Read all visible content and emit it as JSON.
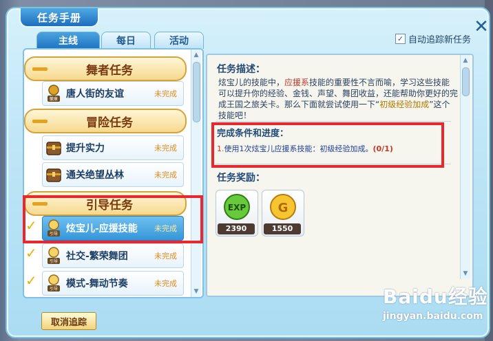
{
  "window": {
    "title": "任务手册",
    "close_glyph": "✕"
  },
  "header": {
    "auto_track_label": "自动追踪新任务",
    "auto_track_checked": true,
    "checkbox_glyph": "✓"
  },
  "tabs": [
    {
      "label": "主线",
      "active": true
    },
    {
      "label": "每日",
      "active": false
    },
    {
      "label": "活动",
      "active": false
    }
  ],
  "categories": [
    {
      "label": "舞者任务"
    },
    {
      "label": "冒险任务"
    },
    {
      "label": "引导任务"
    }
  ],
  "tasks": [
    {
      "name": "唐人街的友谊",
      "status": "未完成",
      "icon": "badge-icon",
      "tracked": false,
      "selected": false
    },
    {
      "name": "提升实力",
      "status": "未完成",
      "icon": "chest-icon",
      "tracked": false,
      "selected": false
    },
    {
      "name": "通关绝望丛林",
      "status": "未完成",
      "icon": "chest-icon",
      "tracked": false,
      "selected": false
    },
    {
      "name": "炫宝儿-应援技能",
      "status": "未完成",
      "icon": "guide-icon",
      "tracked": true,
      "selected": true
    },
    {
      "name": "社交-繁荣舞团",
      "status": "未完成",
      "icon": "guide-icon",
      "tracked": true,
      "selected": false
    },
    {
      "name": "模式-舞动节奏",
      "status": "未完成",
      "icon": "guide-icon",
      "tracked": true,
      "selected": false
    }
  ],
  "icon_labels": {
    "badge": "徽章",
    "guide": "引导"
  },
  "check_glyph": "✓",
  "detail": {
    "desc_title": "任务描述：",
    "desc_part1": "炫宝儿的技能中，",
    "desc_highlight": "应援系",
    "desc_part2": "技能的重要性不言而喻，学习这些技能可以提升你的经验、金钱、声望、舞团收益，还能帮助你更好的完成王国之旅关卡。那么下面就尝试使用一下“",
    "desc_highlight2": "初级经验加成",
    "desc_part3": "”这个技能吧！",
    "cond_title": "完成条件和进度：",
    "cond_index": "1.",
    "cond_text": "使用1次炫宝儿应援系技能：初级经验加成。",
    "cond_progress": "(0/1)",
    "reward_title": "任务奖励：",
    "rewards": [
      {
        "type": "exp-icon",
        "label": "EXP",
        "value": "2390"
      },
      {
        "type": "gold-coin-icon",
        "label": "G",
        "value": "1550"
      }
    ]
  },
  "footer": {
    "cancel_track_label": "取消追踪"
  },
  "scroll_arrows": {
    "up": "▲",
    "down": "▼"
  },
  "watermark": {
    "main": "Baidu经验",
    "sub": "jingyan.baidu.com"
  },
  "colors": {
    "annotation_red": "#e8282e",
    "accent_blue": "#1f73c0",
    "status_orange": "#e38a1c"
  }
}
